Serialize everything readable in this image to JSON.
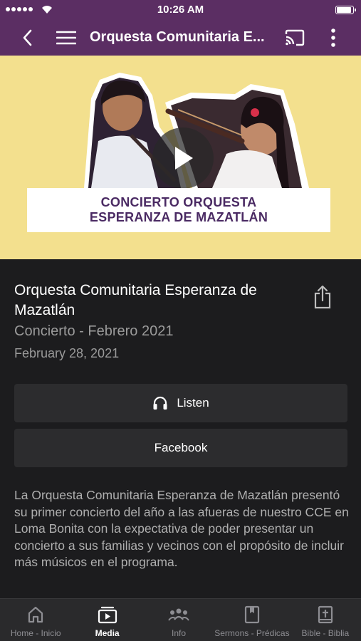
{
  "status": {
    "time": "10:26 AM"
  },
  "navbar": {
    "title": "Orquesta Comunitaria E..."
  },
  "hero": {
    "banner_line1": "CONCIERTO ORQUESTA",
    "banner_line2": "ESPERANZA DE MAZATLÁN"
  },
  "media": {
    "title": "Orquesta Comunitaria Esperanza de Mazatlán",
    "subtitle": "Concierto - Febrero 2021",
    "date": "February 28, 2021",
    "listen_label": "Listen",
    "facebook_label": "Facebook",
    "description": "La Orquesta Comunitaria Esperanza de Mazatlán presentó su primer concierto del año a las afueras de nuestro CCE en Loma Bonita con la expectativa de poder presentar un concierto a sus familias y vecinos con el propósito de incluir más músicos en el programa."
  },
  "tabs": [
    {
      "label": "Home - Inicio",
      "icon": "home-icon",
      "active": false
    },
    {
      "label": "Media",
      "icon": "media-icon",
      "active": true
    },
    {
      "label": "Info",
      "icon": "people-icon",
      "active": false
    },
    {
      "label": "Sermons - Prédicas",
      "icon": "book-icon",
      "active": false
    },
    {
      "label": "Bible - Biblia",
      "icon": "bible-icon",
      "active": false
    }
  ],
  "colors": {
    "brand": "#5b2e63",
    "hero_bg": "#f3e08e",
    "background": "#1c1c1e",
    "button_bg": "#2c2c2e"
  }
}
